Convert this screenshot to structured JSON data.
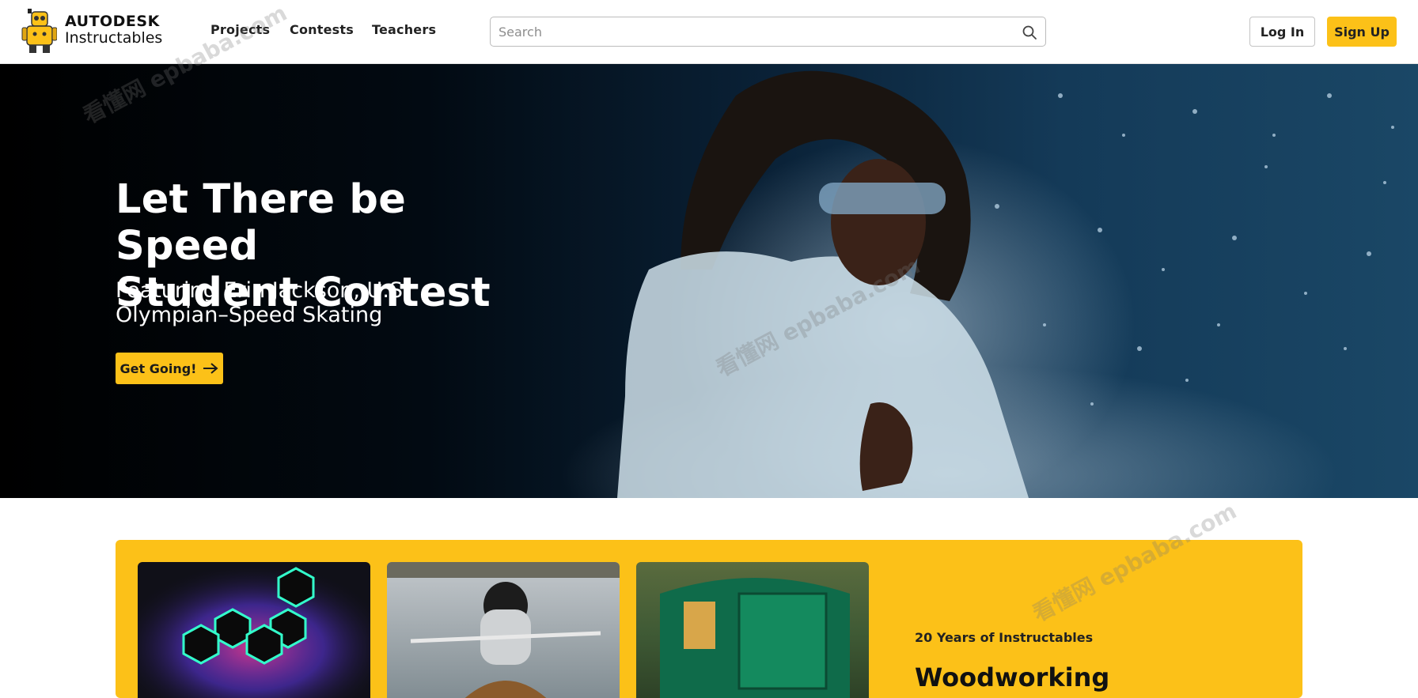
{
  "header": {
    "logo": {
      "brand": "AUTODESK",
      "name": "Instructables",
      "icon": "robot-mascot-icon"
    },
    "nav": [
      {
        "label": "Projects"
      },
      {
        "label": "Contests"
      },
      {
        "label": "Teachers"
      }
    ],
    "search": {
      "placeholder": "Search",
      "value": "",
      "icon": "search-icon"
    },
    "login_label": "Log In",
    "signup_label": "Sign Up"
  },
  "hero": {
    "title_line1": "Let There be Speed",
    "title_line2": "Student Contest",
    "subtitle_line1": "Featuring Erin Jackson, U.S.",
    "subtitle_line2": "Olympian–Speed Skating",
    "cta_label": "Get Going!",
    "cta_icon": "arrow-right-icon"
  },
  "feature": {
    "kicker": "20 Years of Instructables",
    "title": "Woodworking",
    "cards": [
      {
        "image": "hexagon-led-lights"
      },
      {
        "image": "person-in-canoe"
      },
      {
        "image": "green-caravan-wagon"
      }
    ]
  },
  "watermark": {
    "text_cn": "看懂网",
    "text_en": "epbaba.com"
  },
  "colors": {
    "accent": "#fcc118",
    "hero_bg": "#0a2238",
    "text": "#222222"
  }
}
